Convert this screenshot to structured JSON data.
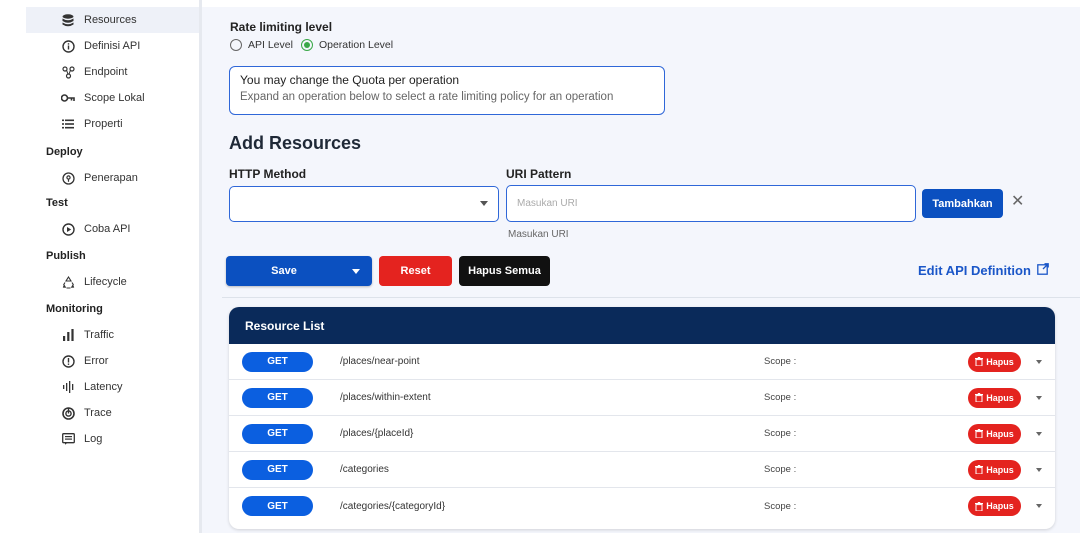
{
  "sidebar": {
    "items": [
      {
        "label": "Resources",
        "icon": "database-icon",
        "active": true
      },
      {
        "label": "Definisi API",
        "icon": "info-icon"
      },
      {
        "label": "Endpoint",
        "icon": "endpoint-icon"
      },
      {
        "label": "Scope Lokal",
        "icon": "key-icon"
      },
      {
        "label": "Properti",
        "icon": "list-icon"
      }
    ],
    "sections": {
      "deploy": "Deploy",
      "test": "Test",
      "publish": "Publish",
      "monitoring": "Monitoring"
    },
    "deploy_items": [
      {
        "label": "Penerapan",
        "icon": "location-icon"
      }
    ],
    "test_items": [
      {
        "label": "Coba API",
        "icon": "play-icon"
      }
    ],
    "publish_items": [
      {
        "label": "Lifecycle",
        "icon": "recycle-icon"
      }
    ],
    "monitoring_items": [
      {
        "label": "Traffic",
        "icon": "bar-chart-icon"
      },
      {
        "label": "Error",
        "icon": "alert-icon"
      },
      {
        "label": "Latency",
        "icon": "latency-icon"
      },
      {
        "label": "Trace",
        "icon": "trace-icon"
      },
      {
        "label": "Log",
        "icon": "log-icon"
      }
    ]
  },
  "rate_limit": {
    "title": "Rate limiting level",
    "options": [
      "API Level",
      "Operation Level"
    ],
    "selected": "Operation Level",
    "info_line1": "You may change the Quota per operation",
    "info_line2": "Expand an operation below to select a rate limiting policy for an operation"
  },
  "add_resources": {
    "title": "Add Resources",
    "http_method_label": "HTTP Method",
    "uri_pattern_label": "URI Pattern",
    "uri_placeholder": "Masukan URI",
    "uri_helper": "Masukan URI",
    "add_button": "Tambahkan"
  },
  "actions": {
    "save": "Save",
    "reset": "Reset",
    "delete_all": "Hapus Semua",
    "edit_definition": "Edit API Definition"
  },
  "resource_list": {
    "title": "Resource List",
    "rows": [
      {
        "method": "GET",
        "path": "/places/near-point",
        "scope": "Scope :",
        "delete": "Hapus"
      },
      {
        "method": "GET",
        "path": "/places/within-extent",
        "scope": "Scope :",
        "delete": "Hapus"
      },
      {
        "method": "GET",
        "path": "/places/{placeId}",
        "scope": "Scope :",
        "delete": "Hapus"
      },
      {
        "method": "GET",
        "path": "/categories",
        "scope": "Scope :",
        "delete": "Hapus"
      },
      {
        "method": "GET",
        "path": "/categories/{categoryId}",
        "scope": "Scope :",
        "delete": "Hapus"
      }
    ]
  },
  "colors": {
    "primary": "#0b50c0",
    "danger": "#e4231f",
    "header_navy": "#0a2a5a",
    "radio_green": "#3aa848",
    "get_blue": "#0b5fe0"
  }
}
